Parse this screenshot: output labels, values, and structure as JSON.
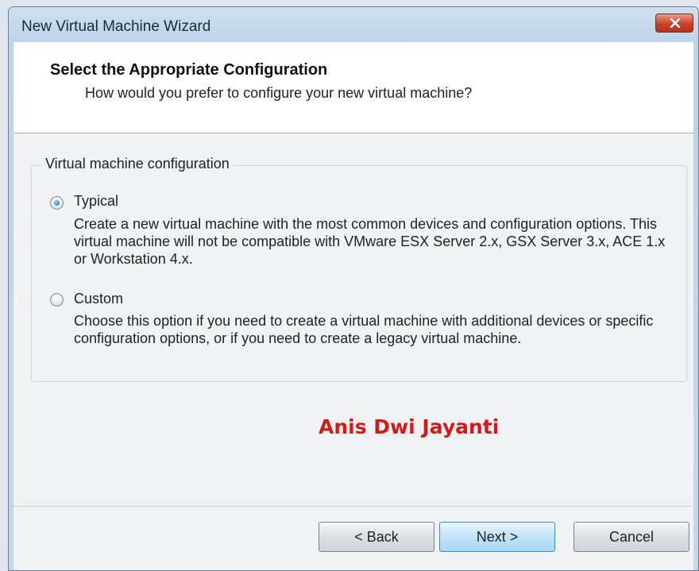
{
  "window": {
    "title": "New Virtual Machine Wizard"
  },
  "header": {
    "title": "Select the Appropriate Configuration",
    "subtitle": "How would you prefer to configure your new virtual machine?"
  },
  "config": {
    "group_label": "Virtual machine configuration",
    "options": [
      {
        "label": "Typical",
        "selected": true,
        "description": "Create a new virtual machine with the most common devices and configuration options. This virtual machine will not be compatible with VMware ESX Server 2.x, GSX Server 3.x, ACE 1.x or Workstation 4.x."
      },
      {
        "label": "Custom",
        "selected": false,
        "description": "Choose this option if you need to create a virtual machine with additional devices or specific configuration options, or if you need to create a legacy virtual machine."
      }
    ]
  },
  "watermark": "Anis Dwi Jayanti",
  "buttons": {
    "back": "< Back",
    "next": "Next >",
    "cancel": "Cancel"
  },
  "colors": {
    "watermark": "#d21a1a",
    "close_button": "#c9412b"
  },
  "icons": {
    "close": "close-icon"
  }
}
